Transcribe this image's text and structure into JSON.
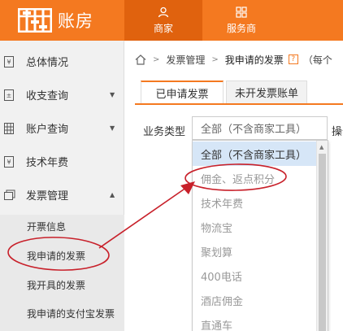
{
  "header": {
    "logo_text": "账房",
    "tabs": [
      {
        "label": "商家",
        "icon": "person-icon"
      },
      {
        "label": "服务商",
        "icon": "grid-icon"
      }
    ],
    "colors": {
      "brand": "#f47920",
      "active_tab": "#e0620e"
    }
  },
  "sidebar": {
    "items": [
      {
        "label": "总体情况",
        "icon": "overview-icon"
      },
      {
        "label": "收支查询",
        "icon": "income-icon",
        "caret": "▼"
      },
      {
        "label": "账户查询",
        "icon": "account-icon",
        "caret": "▼"
      },
      {
        "label": "技术年费",
        "icon": "fee-icon"
      },
      {
        "label": "发票管理",
        "icon": "invoice-icon",
        "caret": "▲"
      }
    ],
    "sub_items": [
      {
        "label": "开票信息"
      },
      {
        "label": "我申请的发票"
      },
      {
        "label": "我开具的发票"
      },
      {
        "label": "我申请的支付宝发票"
      }
    ]
  },
  "breadcrumb": {
    "sep": ">",
    "parent": "发票管理",
    "current": "我申请的发票",
    "help": "?",
    "note": "（每个"
  },
  "tabs": [
    {
      "label": "已申请发票",
      "active": true
    },
    {
      "label": "未开发票账单",
      "active": false
    }
  ],
  "filter": {
    "label": "业务类型",
    "selected": "全部（不含商家工具）",
    "next_label": "操作"
  },
  "dropdown": {
    "options": [
      "全部（不含商家工具）",
      "佣金、返点积分",
      "技术年费",
      "物流宝",
      "聚划算",
      "400电话",
      "酒店佣金",
      "直通车"
    ]
  },
  "annotation_color": "#c8202a"
}
